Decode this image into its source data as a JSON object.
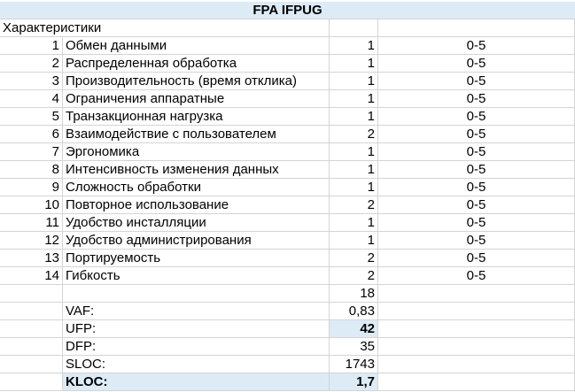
{
  "title": "FPA IFPUG",
  "header": {
    "characteristics_label": "Характеристики"
  },
  "characteristics": [
    {
      "num": "1",
      "name": "Обмен данными",
      "value": "1",
      "range": "0-5"
    },
    {
      "num": "2",
      "name": "Распределенная обработка",
      "value": "1",
      "range": "0-5"
    },
    {
      "num": "3",
      "name": "Производительность (время отклика)",
      "value": "1",
      "range": "0-5"
    },
    {
      "num": "4",
      "name": "Ограничения аппаратные",
      "value": "1",
      "range": "0-5"
    },
    {
      "num": "5",
      "name": "Транзакционная нагрузка",
      "value": "1",
      "range": "0-5"
    },
    {
      "num": "6",
      "name": "Взаимодействие с пользователем",
      "value": "2",
      "range": "0-5"
    },
    {
      "num": "7",
      "name": "Эргономика",
      "value": "1",
      "range": "0-5"
    },
    {
      "num": "8",
      "name": "Интенсивность изменения данных",
      "value": "1",
      "range": "0-5"
    },
    {
      "num": "9",
      "name": "Сложность обработки",
      "value": "1",
      "range": "0-5"
    },
    {
      "num": "10",
      "name": "Повторное использование",
      "value": "2",
      "range": "0-5"
    },
    {
      "num": "11",
      "name": "Удобство инсталляции",
      "value": "1",
      "range": "0-5"
    },
    {
      "num": "12",
      "name": "Удобство администрирования",
      "value": "1",
      "range": "0-5"
    },
    {
      "num": "13",
      "name": "Портируемость",
      "value": "2",
      "range": "0-5"
    },
    {
      "num": "14",
      "name": "Гибкость",
      "value": "2",
      "range": "0-5"
    }
  ],
  "sum": "18",
  "metrics": {
    "vaf": {
      "label": "VAF:",
      "value": "0,83"
    },
    "ufp": {
      "label": "UFP:",
      "value": "42"
    },
    "dfp": {
      "label": "DFP:",
      "value": "35"
    },
    "sloc": {
      "label": "SLOC:",
      "value": "1743"
    },
    "kloc": {
      "label": "KLOC:",
      "value": "1,7"
    }
  },
  "colors": {
    "highlight": "#ddebf7",
    "grid": "#d4d4d4"
  }
}
